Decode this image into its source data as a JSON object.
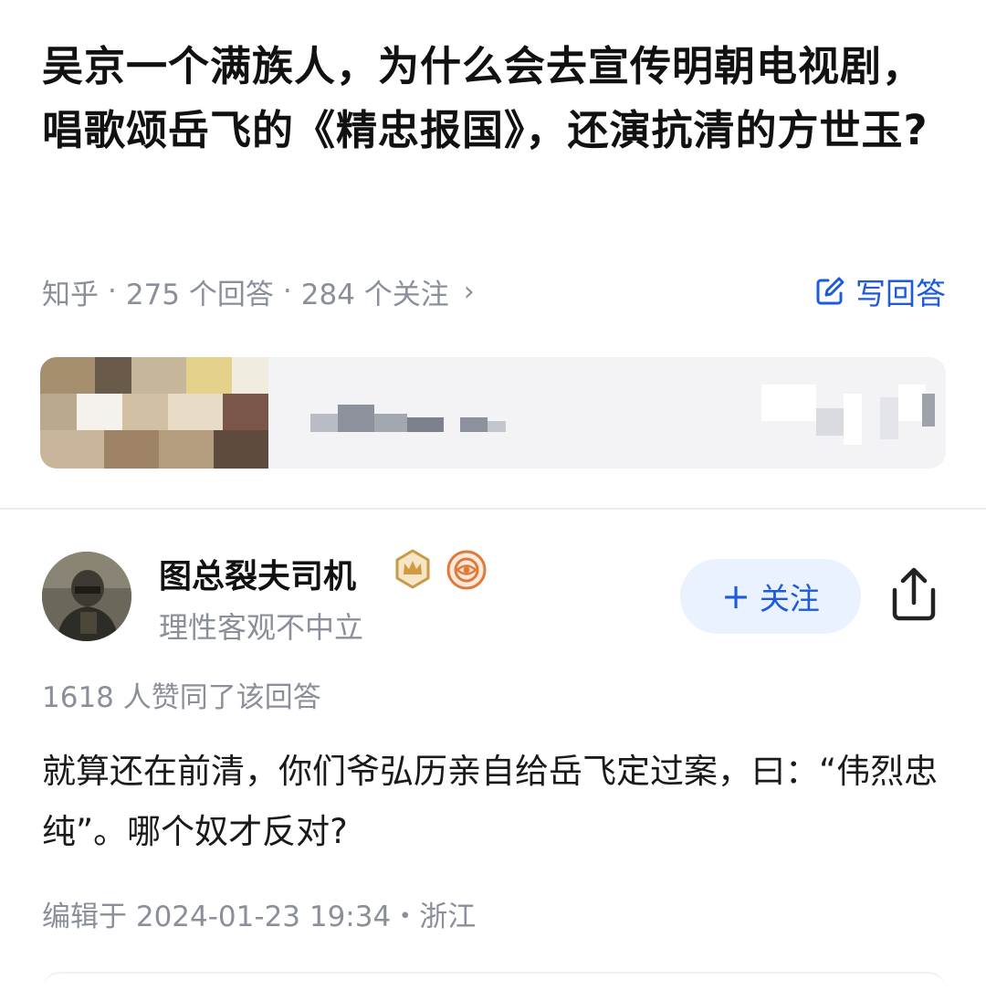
{
  "question": {
    "title": "吴京一个满族人，为什么会去宣传明朝电视剧，唱歌颂岳飞的《精忠报国》，还演抗清的方世玉?",
    "source": "知乎",
    "answers": "275 个回答",
    "followers": "284 个关注",
    "write_answer_label": "写回答"
  },
  "author": {
    "name": "图总裂夫司机",
    "bio": "理性客观不中立",
    "follow_label": "关注"
  },
  "answer": {
    "upvotes": "1618 人赞同了该回答",
    "content": "就算还在前清，你们爷弘历亲自给岳飞定过案，曰：“伟烈忠纯”。哪个奴才反对?",
    "edited": "编辑于 2024-01-23 19:34・浙江"
  },
  "colors": {
    "accent": "#1e5bd8",
    "follow_bg": "#eaf2ff",
    "muted": "#8a8f99"
  }
}
